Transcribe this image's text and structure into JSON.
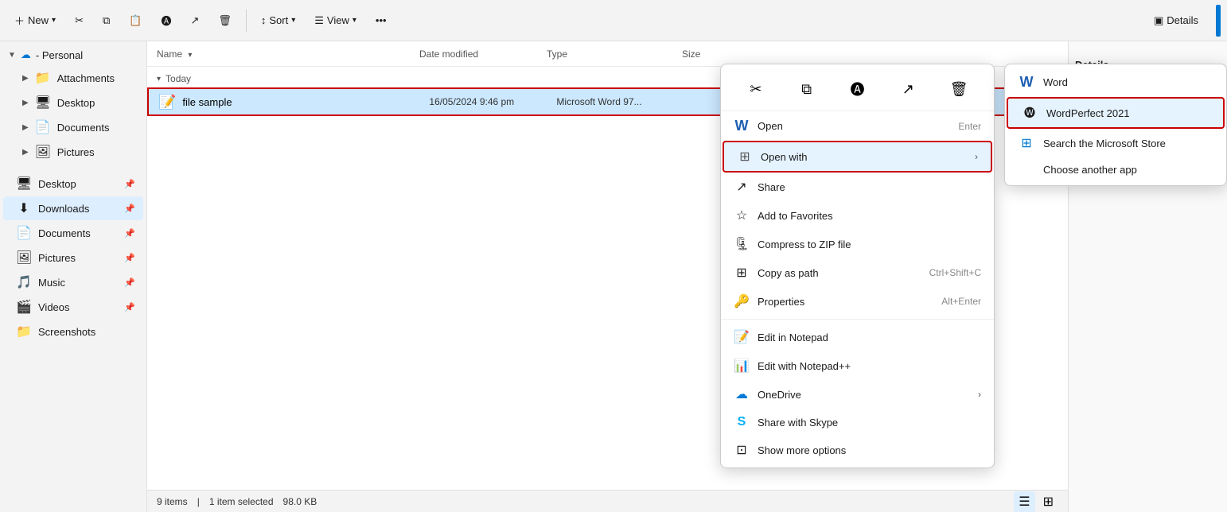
{
  "toolbar": {
    "new_label": "New",
    "cut_icon": "✂",
    "copy_icon": "⎘",
    "paste_icon": "📋",
    "rename_icon": "Ⓐ",
    "share_icon": "↗",
    "delete_icon": "🗑",
    "sort_label": "Sort",
    "view_label": "View",
    "more_icon": "•••",
    "details_label": "Details"
  },
  "sidebar": {
    "top_item": {
      "label": "- Personal",
      "cloud_icon": "☁"
    },
    "tree_items": [
      {
        "label": "Attachments",
        "icon": "📁",
        "pinned": false,
        "indent": 1
      },
      {
        "label": "Desktop",
        "icon": "🖥",
        "pinned": false,
        "indent": 1
      },
      {
        "label": "Documents",
        "icon": "📄",
        "pinned": false,
        "indent": 1
      },
      {
        "label": "Pictures",
        "icon": "🖼",
        "pinned": false,
        "indent": 1
      }
    ],
    "pinned_items": [
      {
        "label": "Desktop",
        "icon": "🖥",
        "pinned": true
      },
      {
        "label": "Downloads",
        "icon": "⬇",
        "pinned": true,
        "active": true
      },
      {
        "label": "Documents",
        "icon": "📄",
        "pinned": true
      },
      {
        "label": "Pictures",
        "icon": "🖼",
        "pinned": true
      },
      {
        "label": "Music",
        "icon": "🎵",
        "pinned": true
      },
      {
        "label": "Videos",
        "icon": "🎬",
        "pinned": true
      },
      {
        "label": "Screenshots",
        "icon": "📁",
        "pinned": false
      }
    ]
  },
  "file_list": {
    "columns": {
      "name": "Name",
      "date_modified": "Date modified",
      "type": "Type",
      "size": "Size"
    },
    "group_today": "Today",
    "files": [
      {
        "name": "file sample",
        "icon": "📝",
        "date": "16/05/2024 9:46 pm",
        "type": "Microsoft Word 97...",
        "size": "",
        "selected": true
      }
    ]
  },
  "statusbar": {
    "items_count": "9 items",
    "selection": "1 item selected",
    "size": "98.0 KB"
  },
  "context_menu": {
    "icons": [
      {
        "name": "cut",
        "icon": "✂",
        "label": "Cut"
      },
      {
        "name": "copy",
        "icon": "⎘",
        "label": "Copy"
      },
      {
        "name": "rename",
        "icon": "Ⓐ",
        "label": "Rename"
      },
      {
        "name": "share",
        "icon": "↗",
        "label": "Share"
      },
      {
        "name": "delete",
        "icon": "🗑",
        "label": "Delete"
      }
    ],
    "items": [
      {
        "id": "open",
        "icon": "W",
        "icon_color": "#1e5fb3",
        "label": "Open",
        "shortcut": "Enter",
        "has_arrow": false,
        "separator_after": false,
        "highlighted": false
      },
      {
        "id": "open_with",
        "icon": "⊞",
        "icon_color": "#555",
        "label": "Open with",
        "shortcut": "",
        "has_arrow": true,
        "separator_after": false,
        "highlighted": true
      },
      {
        "id": "share",
        "icon": "↗",
        "icon_color": "#555",
        "label": "Share",
        "shortcut": "",
        "has_arrow": false,
        "separator_after": false,
        "highlighted": false
      },
      {
        "id": "add_favorites",
        "icon": "☆",
        "icon_color": "#555",
        "label": "Add to Favorites",
        "shortcut": "",
        "has_arrow": false,
        "separator_after": false,
        "highlighted": false
      },
      {
        "id": "compress",
        "icon": "🗜",
        "icon_color": "#555",
        "label": "Compress to ZIP file",
        "shortcut": "",
        "has_arrow": false,
        "separator_after": false,
        "highlighted": false
      },
      {
        "id": "copy_path",
        "icon": "⊞",
        "icon_color": "#555",
        "label": "Copy as path",
        "shortcut": "Ctrl+Shift+C",
        "has_arrow": false,
        "separator_after": false,
        "highlighted": false
      },
      {
        "id": "properties",
        "icon": "🔑",
        "icon_color": "#555",
        "label": "Properties",
        "shortcut": "Alt+Enter",
        "has_arrow": false,
        "separator_after": true,
        "highlighted": false
      },
      {
        "id": "edit_notepad",
        "icon": "📝",
        "icon_color": "#555",
        "label": "Edit in Notepad",
        "shortcut": "",
        "has_arrow": false,
        "separator_after": false,
        "highlighted": false
      },
      {
        "id": "edit_notepadpp",
        "icon": "📊",
        "icon_color": "#555",
        "label": "Edit with Notepad++",
        "shortcut": "",
        "has_arrow": false,
        "separator_after": false,
        "highlighted": false
      },
      {
        "id": "onedrive",
        "icon": "☁",
        "icon_color": "#0078d4",
        "label": "OneDrive",
        "shortcut": "",
        "has_arrow": true,
        "separator_after": false,
        "highlighted": false
      },
      {
        "id": "share_skype",
        "icon": "S",
        "icon_color": "#00aff0",
        "label": "Share with Skype",
        "shortcut": "",
        "has_arrow": false,
        "separator_after": false,
        "highlighted": false
      },
      {
        "id": "show_more",
        "icon": "⊡",
        "icon_color": "#555",
        "label": "Show more options",
        "shortcut": "",
        "has_arrow": false,
        "separator_after": false,
        "highlighted": false
      }
    ]
  },
  "submenu": {
    "items": [
      {
        "id": "word",
        "icon": "W",
        "icon_color": "#1e5fb3",
        "label": "Word",
        "highlighted": false
      },
      {
        "id": "wordperfect",
        "icon": "🅦",
        "icon_color": "#555",
        "label": "WordPerfect 2021",
        "highlighted": true
      },
      {
        "id": "store",
        "icon": "⊞",
        "icon_color": "#0078d4",
        "label": "Search the Microsoft Store",
        "highlighted": false
      },
      {
        "id": "another",
        "icon": "",
        "label": "Choose another app",
        "highlighted": false
      }
    ]
  }
}
